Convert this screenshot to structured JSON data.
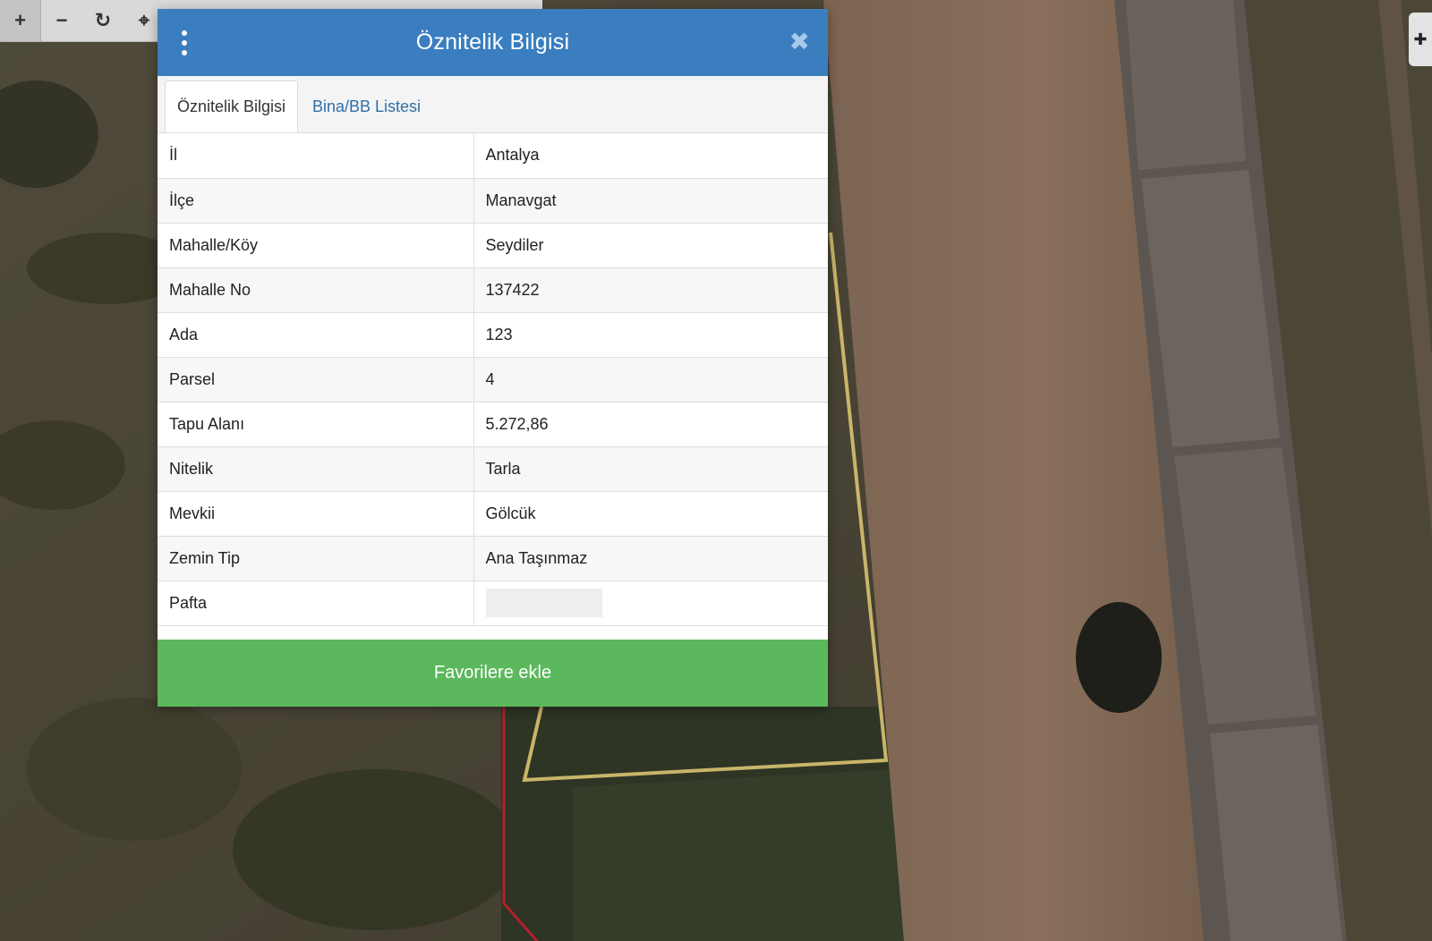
{
  "toolbar": {
    "zoom_in_icon": "+",
    "zoom_out_icon": "−",
    "refresh_icon": "↻",
    "locate_icon": "⌖"
  },
  "dialog": {
    "title": "Öznitelik Bilgisi",
    "close_icon": "✖",
    "tabs": [
      {
        "label": "Öznitelik Bilgisi",
        "active": true
      },
      {
        "label": "Bina/BB Listesi",
        "active": false
      }
    ],
    "rows": [
      {
        "key": "İl",
        "value": "Antalya"
      },
      {
        "key": "İlçe",
        "value": "Manavgat"
      },
      {
        "key": "Mahalle/Köy",
        "value": "Seydiler"
      },
      {
        "key": "Mahalle No",
        "value": "137422"
      },
      {
        "key": "Ada",
        "value": "123"
      },
      {
        "key": "Parsel",
        "value": "4"
      },
      {
        "key": "Tapu Alanı",
        "value": "5.272,86"
      },
      {
        "key": "Nitelik",
        "value": "Tarla"
      },
      {
        "key": "Mevkii",
        "value": "Gölcük"
      },
      {
        "key": "Zemin Tip",
        "value": "Ana Taşınmaz"
      },
      {
        "key": "Pafta",
        "value": ""
      }
    ],
    "favorite_button": "Favorilere ekle"
  },
  "colors": {
    "header": "#3a7ebf",
    "favorite": "#5cb85c",
    "parcel_outline": "#c9b56a",
    "boundary_line": "#b3202a"
  }
}
